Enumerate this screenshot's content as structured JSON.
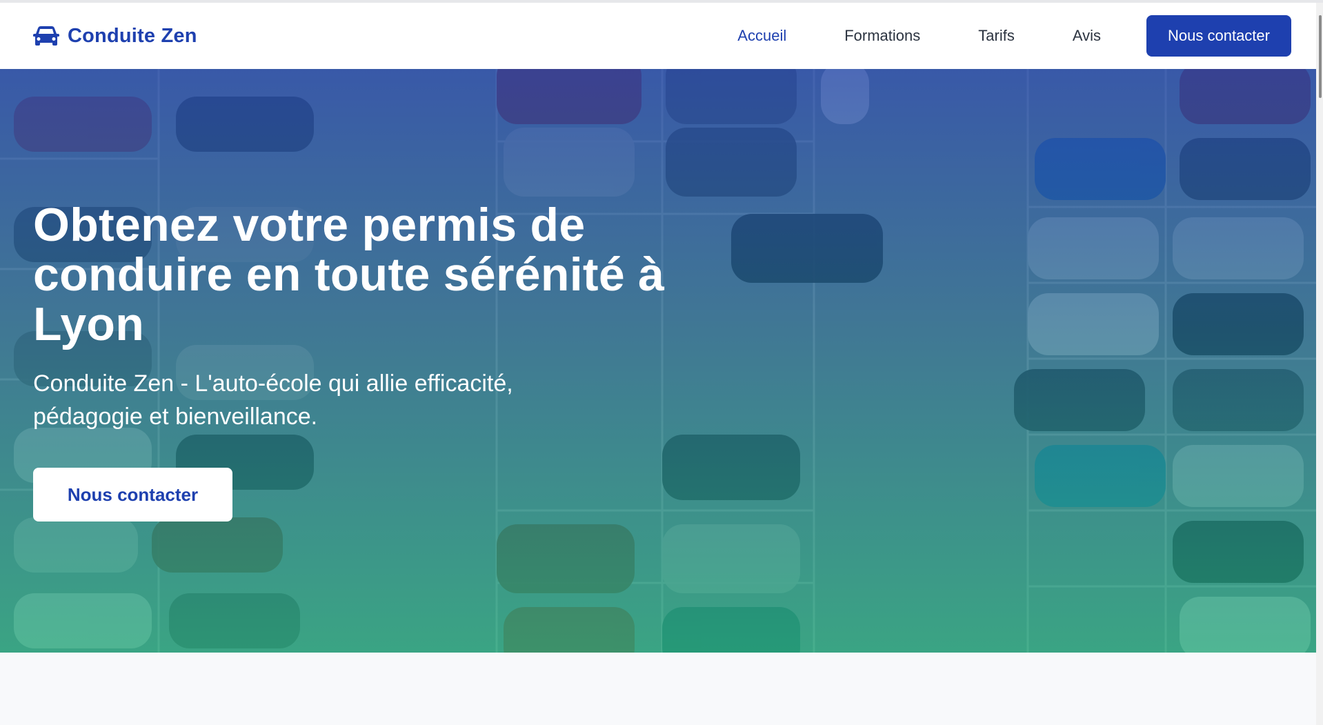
{
  "brand": {
    "name": "Conduite Zen",
    "icon": "car-icon",
    "color": "#1e40af"
  },
  "nav": {
    "items": [
      {
        "label": "Accueil",
        "active": true
      },
      {
        "label": "Formations",
        "active": false
      },
      {
        "label": "Tarifs",
        "active": false
      },
      {
        "label": "Avis",
        "active": false
      }
    ],
    "cta_label": "Nous contacter"
  },
  "hero": {
    "title": "Obtenez votre permis de conduire en toute sérénité à Lyon",
    "subtitle": "Conduite Zen - L'auto-école qui allie efficacité, pédagogie et bienveillance.",
    "cta_label": "Nous contacter",
    "background": "aerial-parking-lot-photo",
    "gradient_top": "#2548aa",
    "gradient_bottom": "#20aa78"
  }
}
